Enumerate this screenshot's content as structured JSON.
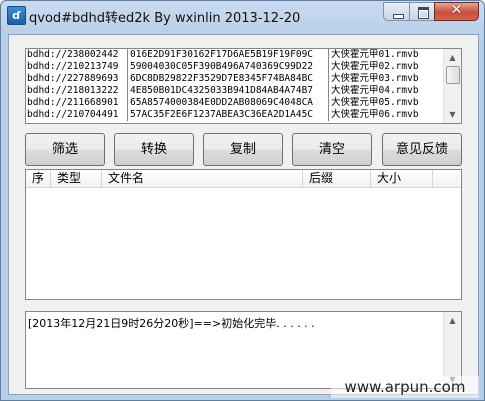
{
  "window": {
    "title": "qvod#bdhd转ed2k    By wxinlin 2013-12-20",
    "icon": "app-icon",
    "icon_glyph": "ɗ"
  },
  "controls": {
    "minimize": "minimize-icon",
    "maximize": "maximize-icon",
    "close": "close-icon",
    "close_glyph": "✕"
  },
  "link_list": [
    {
      "prefix": "bdhd://238002442",
      "hash": "016E2D91F30162F17D6AE5B19F19F09C",
      "name": "大侠霍元甲01.rmvb"
    },
    {
      "prefix": "bdhd://210213749",
      "hash": "59004030C05F390B496A740369C99D22",
      "name": "大侠霍元甲02.rmvb"
    },
    {
      "prefix": "bdhd://227889693",
      "hash": "6DC8DB29822F3529D7E8345F74BA84BC",
      "name": "大侠霍元甲03.rmvb"
    },
    {
      "prefix": "bdhd://218013222",
      "hash": "4E850B01DC4325033B941D84AB4A74B7",
      "name": "大侠霍元甲04.rmvb"
    },
    {
      "prefix": "bdhd://211668901",
      "hash": "65A8574000384E0DD2AB08069C4048CA",
      "name": "大侠霍元甲05.rmvb"
    },
    {
      "prefix": "bdhd://210704491",
      "hash": "57AC35F2E6F1237ABEA3C36EA2D1A45C",
      "name": "大侠霍元甲06.rmvb"
    }
  ],
  "scroll_arrows": {
    "up": "▲",
    "down": "▼"
  },
  "buttons": {
    "filter": "筛选",
    "convert": "转换",
    "copy": "复制",
    "clear": "清空",
    "feedback": "意见反馈"
  },
  "table": {
    "columns": [
      "序",
      "类型",
      "文件名",
      "后缀",
      "大小"
    ]
  },
  "log": {
    "text": "[2013年12月21日9时26分20秒]==>初始化完毕. . . . . ."
  },
  "watermark": "www.arpun.com"
}
